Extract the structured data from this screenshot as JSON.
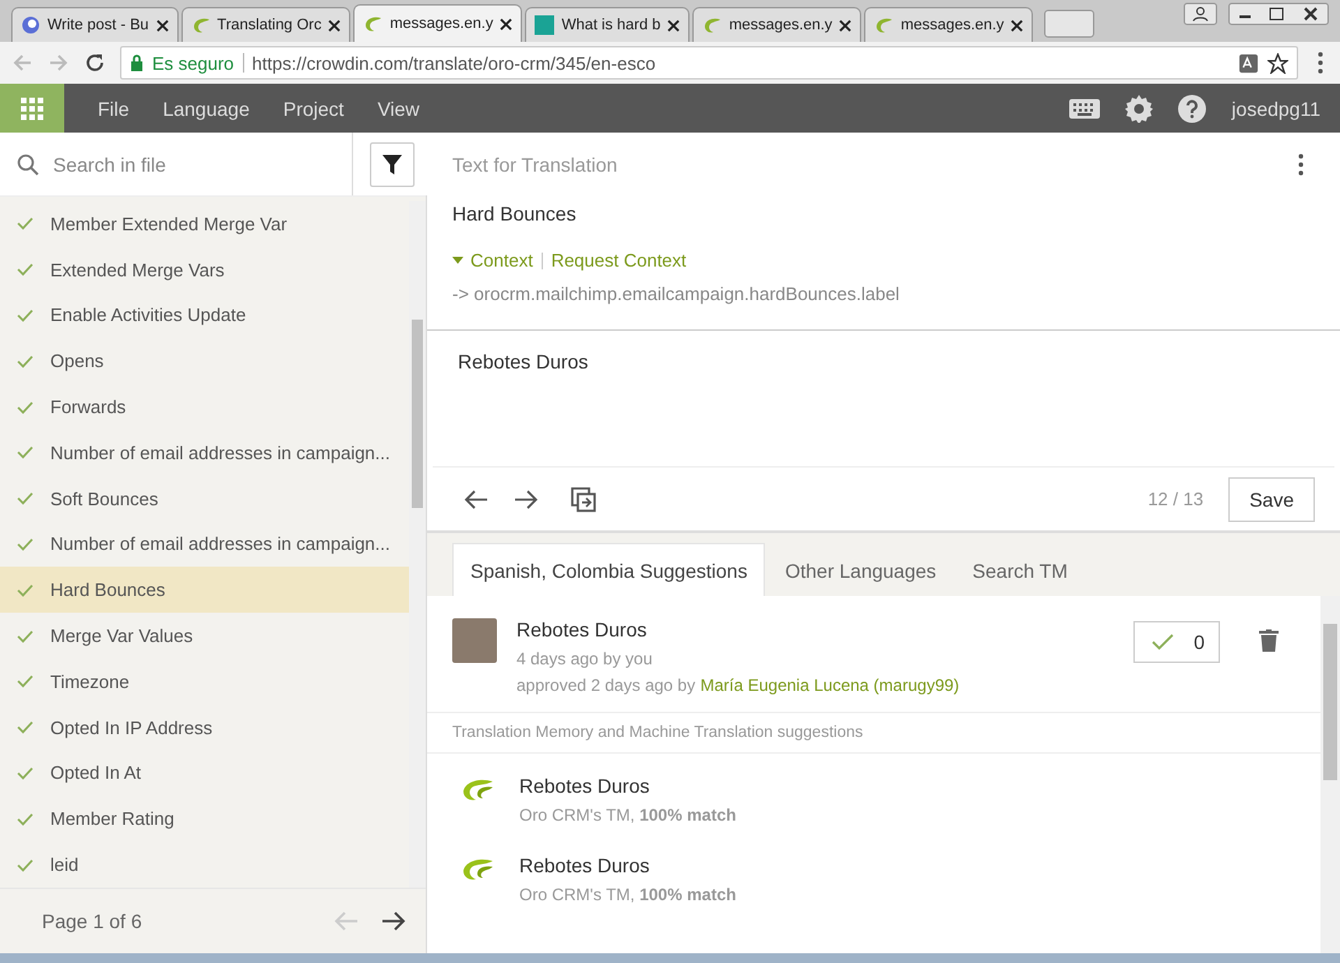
{
  "browser": {
    "tabs": [
      {
        "title": "Write post - Bu",
        "kind": "blog",
        "selected": false
      },
      {
        "title": "Translating Orc",
        "kind": "crowdin",
        "selected": false
      },
      {
        "title": "messages.en.y",
        "kind": "crowdin",
        "selected": true
      },
      {
        "title": "What is hard b",
        "kind": "doc",
        "selected": false
      },
      {
        "title": "messages.en.y",
        "kind": "crowdin",
        "selected": false
      },
      {
        "title": "messages.en.y",
        "kind": "crowdin",
        "selected": false
      }
    ],
    "secure_label": "Es seguro",
    "url": "https://crowdin.com/translate/oro-crm/345/en-esco"
  },
  "app_nav": {
    "menu": [
      "File",
      "Language",
      "Project",
      "View"
    ],
    "user": "josedpg11"
  },
  "sidebar": {
    "search": {
      "placeholder": "Search in file"
    },
    "items": [
      {
        "label": "Member Extended Merge Var",
        "translated": true,
        "selected": false
      },
      {
        "label": "Extended Merge Vars",
        "translated": true,
        "selected": false
      },
      {
        "label": "Enable Activities Update",
        "translated": true,
        "selected": false
      },
      {
        "label": "Opens",
        "translated": true,
        "selected": false
      },
      {
        "label": "Forwards",
        "translated": true,
        "selected": false
      },
      {
        "label": "Number of email addresses in campaign...",
        "translated": true,
        "selected": false
      },
      {
        "label": "Soft Bounces",
        "translated": true,
        "selected": false
      },
      {
        "label": "Number of email addresses in campaign...",
        "translated": true,
        "selected": false
      },
      {
        "label": "Hard Bounces",
        "translated": true,
        "selected": true
      },
      {
        "label": "Merge Var Values",
        "translated": true,
        "selected": false
      },
      {
        "label": "Timezone",
        "translated": true,
        "selected": false
      },
      {
        "label": "Opted In IP Address",
        "translated": true,
        "selected": false
      },
      {
        "label": "Opted In At",
        "translated": true,
        "selected": false
      },
      {
        "label": "Member Rating",
        "translated": true,
        "selected": false
      },
      {
        "label": "leid",
        "translated": true,
        "selected": false
      }
    ],
    "pager": "Page 1 of 6"
  },
  "editor": {
    "header": "Text for Translation",
    "source": "Hard Bounces",
    "context_link": "Context",
    "request_context": "Request Context",
    "key": "-> orocrm.mailchimp.emailcampaign.hardBounces.label",
    "translation": "Rebotes Duros",
    "counter": "12 / 13",
    "save": "Save"
  },
  "suggestions": {
    "tabs": [
      {
        "label": "Spanish, Colombia Suggestions",
        "selected": true
      },
      {
        "label": "Other Languages",
        "selected": false
      },
      {
        "label": "Search TM",
        "selected": false
      }
    ],
    "own": {
      "text": "Rebotes Duros",
      "meta": "4 days ago by you",
      "approved_prefix": "approved 2 days ago by",
      "approver": "María Eugenia Lucena (marugy99)",
      "votes": "0"
    },
    "tm_heading": "Translation Memory and Machine Translation suggestions",
    "tm": [
      {
        "text": "Rebotes Duros",
        "source": "Oro CRM's TM, **100% match**"
      },
      {
        "text": "Rebotes Duros",
        "source": "Oro CRM's TM, **100% match**"
      }
    ]
  }
}
